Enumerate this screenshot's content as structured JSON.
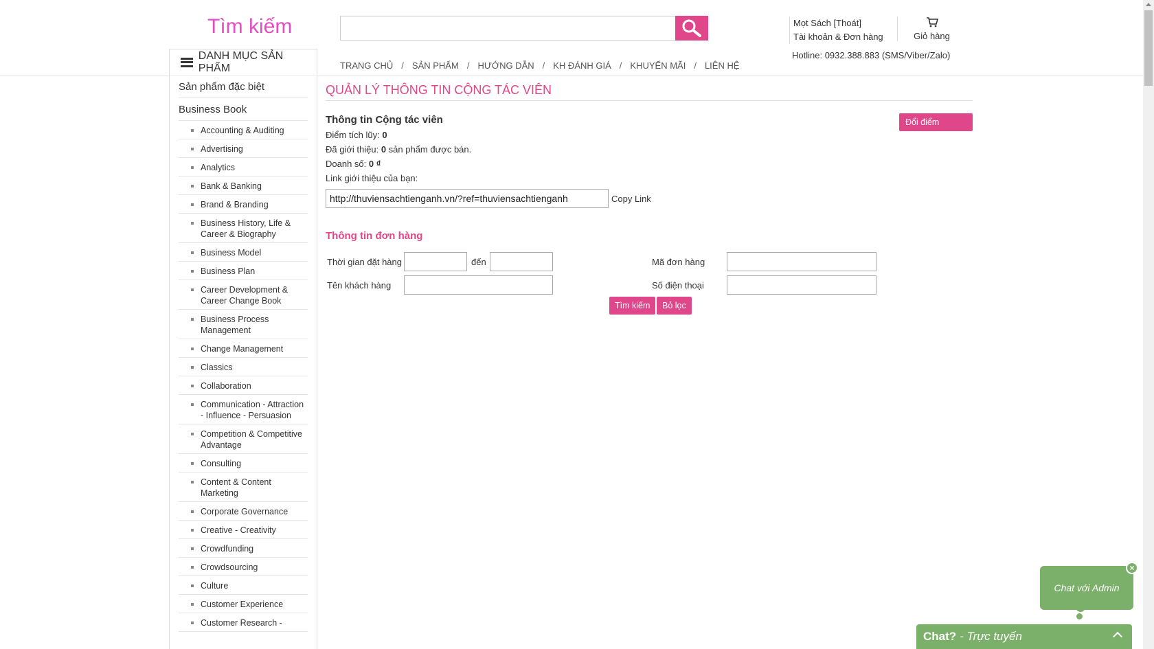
{
  "header": {
    "logo": "Tìm kiếm",
    "search_placeholder": "",
    "account_name": "Mọt Sách [Thoát]",
    "account_orders": "Tài khoản & Đơn hàng",
    "cart_label": "Giỏ hàng",
    "hotline": "Hotline: 0932.388.883 (SMS/Viber/Zalo)"
  },
  "nav": {
    "items": [
      "TRANG CHỦ",
      "SẢN PHẨM",
      "HƯỚNG DẪN",
      "KH ĐÁNH GIÁ",
      "KHUYẾN MÃI",
      "LIÊN HỆ"
    ],
    "separator": "/"
  },
  "sidebar": {
    "title": "DANH MỤC SẢN PHẨM",
    "top_categories": [
      "Sản phẩm đặc biệt",
      "Business Book"
    ],
    "sub_items": [
      "Accounting & Auditing",
      "Advertising",
      "Analytics",
      "Bank & Banking",
      "Brand & Branding",
      "Business History, Life & Career & Biography",
      "Business Model",
      "Business Plan",
      "Career Development & Career Change Book",
      "Business Process Management",
      "Change Management",
      "Classics",
      "Collaboration",
      "Communication - Attraction - Influence - Persuasion",
      "Competition & Competitive Advantage",
      "Consulting",
      "Content & Content Marketing",
      "Corporate Governance",
      "Creative - Creativity",
      "Crowdfunding",
      "Crowdsourcing",
      "Culture",
      "Customer Experience",
      "Customer Research -"
    ]
  },
  "main": {
    "page_title": "QUẢN LÝ THÔNG TIN CỘNG TÁC VIÊN",
    "collab_heading": "Thông tin Cộng tác viên",
    "redeem_button": "Đổi điểm thưởng",
    "points_label": "Điểm tích lũy:",
    "points_value": "0",
    "referred_label": "Đã giới thiệu:",
    "referred_value": "0",
    "referred_suffix": "sản phẩm được bán.",
    "sales_label": "Doanh số:",
    "sales_value": "0 ₫",
    "link_label": "Link giới thiệu của bạn:",
    "link_value": "http://thuviensachtienganh.vn/?ref=thuviensachtienganh",
    "copy_link": "Copy Link",
    "order_heading": "Thông tin đơn hàng",
    "order_time_label": "Thời gian đặt hàng",
    "to_label": "đến",
    "order_code_label": "Mã đơn hàng",
    "customer_name_label": "Tên khách hàng",
    "phone_label": "Số điện thoại",
    "search_button": "Tìm kiếm",
    "filter_button": "Bỏ lọc"
  },
  "chat": {
    "bubble_text": "Chat với Admin",
    "bar_title": "Chat?",
    "bar_status": "- Trực tuyến",
    "close_symbol": "×",
    "color": "#7bb06a"
  },
  "colors": {
    "accent": "#e0478a",
    "logo": "#e34ec0"
  }
}
